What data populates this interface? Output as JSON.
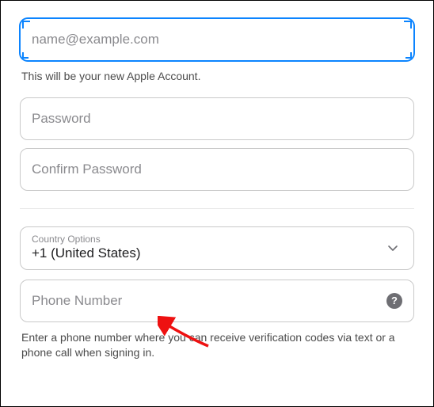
{
  "email": {
    "placeholder": "name@example.com",
    "value": "",
    "helper": "This will be your new Apple Account."
  },
  "password": {
    "placeholder": "Password",
    "value": ""
  },
  "confirm_password": {
    "placeholder": "Confirm Password",
    "value": ""
  },
  "country": {
    "label": "Country Options",
    "value": "+1 (United States)"
  },
  "phone": {
    "placeholder": "Phone Number",
    "value": "",
    "helper": "Enter a phone number where you can receive verification codes via text or a phone call when signing in."
  },
  "help_icon_glyph": "?"
}
